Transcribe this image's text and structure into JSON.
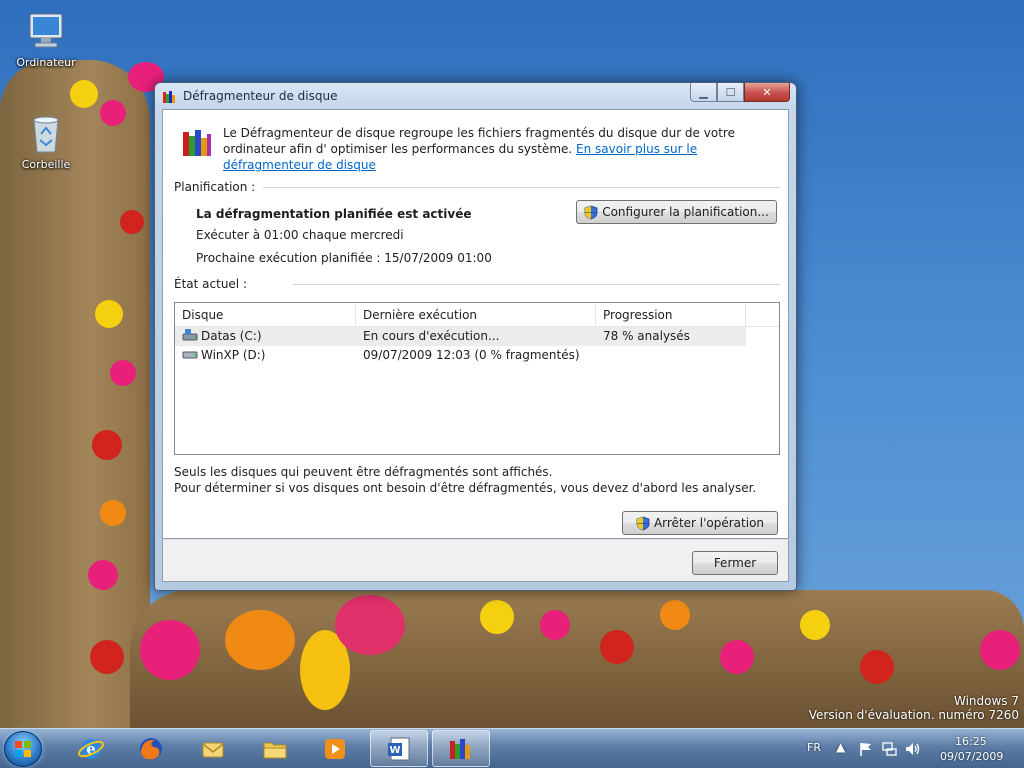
{
  "desktop": {
    "icons": [
      {
        "label": "Ordinateur",
        "icon": "computer-icon"
      },
      {
        "label": "Corbeille",
        "icon": "recycle-bin-icon"
      }
    ],
    "watermark": {
      "line1": "Windows 7",
      "line2": "Version d'évaluation. numéro 7260"
    }
  },
  "window": {
    "title": "Défragmenteur de disque",
    "intro_text": "Le Défragmenteur de disque regroupe les fichiers fragmentés du disque dur de votre ordinateur afin d' optimiser les performances du système.",
    "intro_link": "En savoir plus sur le défragmenteur de disque",
    "planification_label": "Planification :",
    "schedule_status": "La défragmentation planifiée est activée",
    "schedule_run": "Exécuter à 01:00 chaque mercredi",
    "schedule_next": "Prochaine exécution planifiée : 15/07/2009 01:00",
    "configure_button": "Configurer la planification...",
    "etat_label": "État actuel :",
    "columns": [
      "Disque",
      "Dernière exécution",
      "Progression"
    ],
    "disks": [
      {
        "name": "Datas (C:)",
        "last_run": "En cours d'exécution...",
        "progress": "78 % analysés"
      },
      {
        "name": "WinXP (D:)",
        "last_run": "09/07/2009 12:03 (0 % fragmentés)",
        "progress": ""
      }
    ],
    "note_line1": "Seuls les disques qui peuvent être défragmentés sont affichés.",
    "note_line2": "Pour déterminer si vos disques ont besoin d'être défragmentés, vous devez d'abord les analyser.",
    "stop_button": "Arrêter l'opération",
    "close_button": "Fermer",
    "close_glyph": "✕",
    "maximize_glyph": "☐",
    "minimize_glyph": "▁"
  },
  "taskbar": {
    "language": "FR",
    "time": "16:25",
    "date": "09/07/2009",
    "apps": [
      "internet-explorer-icon",
      "firefox-icon",
      "outlook-icon",
      "explorer-icon",
      "media-player-icon",
      "word-icon",
      "defrag-icon"
    ]
  }
}
